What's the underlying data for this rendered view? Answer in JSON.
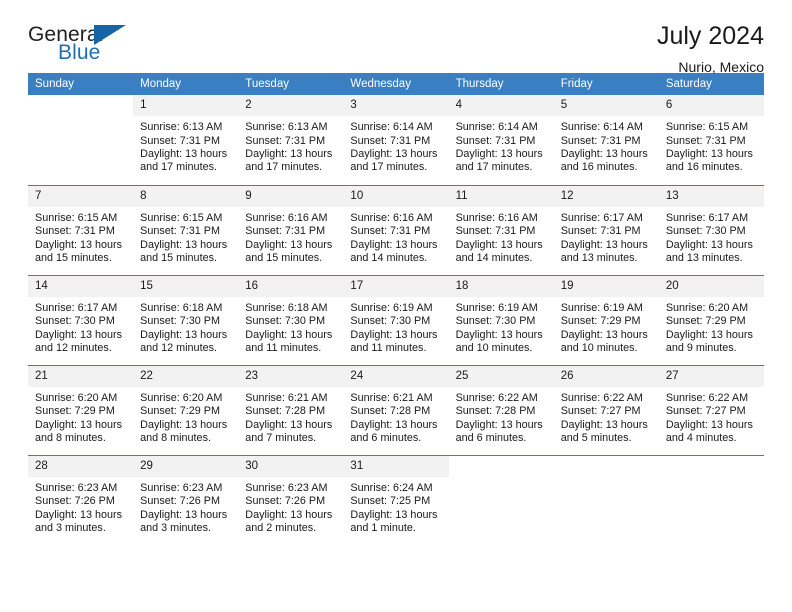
{
  "brand": {
    "name_part1": "General",
    "name_part2": "Blue",
    "accent_color": "#1565a8",
    "logo_icon": "triangle-icon"
  },
  "header": {
    "month_title": "July 2024",
    "location": "Nurio, Mexico"
  },
  "calendar": {
    "header_color": "#3a7fc1",
    "weekday_headers": [
      "Sunday",
      "Monday",
      "Tuesday",
      "Wednesday",
      "Thursday",
      "Friday",
      "Saturday"
    ],
    "weeks": [
      [
        {
          "day": "",
          "blank": true
        },
        {
          "day": "1",
          "sunrise": "Sunrise: 6:13 AM",
          "sunset": "Sunset: 7:31 PM",
          "daylight": "Daylight: 13 hours and 17 minutes."
        },
        {
          "day": "2",
          "sunrise": "Sunrise: 6:13 AM",
          "sunset": "Sunset: 7:31 PM",
          "daylight": "Daylight: 13 hours and 17 minutes."
        },
        {
          "day": "3",
          "sunrise": "Sunrise: 6:14 AM",
          "sunset": "Sunset: 7:31 PM",
          "daylight": "Daylight: 13 hours and 17 minutes."
        },
        {
          "day": "4",
          "sunrise": "Sunrise: 6:14 AM",
          "sunset": "Sunset: 7:31 PM",
          "daylight": "Daylight: 13 hours and 17 minutes."
        },
        {
          "day": "5",
          "sunrise": "Sunrise: 6:14 AM",
          "sunset": "Sunset: 7:31 PM",
          "daylight": "Daylight: 13 hours and 16 minutes."
        },
        {
          "day": "6",
          "sunrise": "Sunrise: 6:15 AM",
          "sunset": "Sunset: 7:31 PM",
          "daylight": "Daylight: 13 hours and 16 minutes."
        }
      ],
      [
        {
          "day": "7",
          "sunrise": "Sunrise: 6:15 AM",
          "sunset": "Sunset: 7:31 PM",
          "daylight": "Daylight: 13 hours and 15 minutes."
        },
        {
          "day": "8",
          "sunrise": "Sunrise: 6:15 AM",
          "sunset": "Sunset: 7:31 PM",
          "daylight": "Daylight: 13 hours and 15 minutes."
        },
        {
          "day": "9",
          "sunrise": "Sunrise: 6:16 AM",
          "sunset": "Sunset: 7:31 PM",
          "daylight": "Daylight: 13 hours and 15 minutes."
        },
        {
          "day": "10",
          "sunrise": "Sunrise: 6:16 AM",
          "sunset": "Sunset: 7:31 PM",
          "daylight": "Daylight: 13 hours and 14 minutes."
        },
        {
          "day": "11",
          "sunrise": "Sunrise: 6:16 AM",
          "sunset": "Sunset: 7:31 PM",
          "daylight": "Daylight: 13 hours and 14 minutes."
        },
        {
          "day": "12",
          "sunrise": "Sunrise: 6:17 AM",
          "sunset": "Sunset: 7:31 PM",
          "daylight": "Daylight: 13 hours and 13 minutes."
        },
        {
          "day": "13",
          "sunrise": "Sunrise: 6:17 AM",
          "sunset": "Sunset: 7:30 PM",
          "daylight": "Daylight: 13 hours and 13 minutes."
        }
      ],
      [
        {
          "day": "14",
          "sunrise": "Sunrise: 6:17 AM",
          "sunset": "Sunset: 7:30 PM",
          "daylight": "Daylight: 13 hours and 12 minutes."
        },
        {
          "day": "15",
          "sunrise": "Sunrise: 6:18 AM",
          "sunset": "Sunset: 7:30 PM",
          "daylight": "Daylight: 13 hours and 12 minutes."
        },
        {
          "day": "16",
          "sunrise": "Sunrise: 6:18 AM",
          "sunset": "Sunset: 7:30 PM",
          "daylight": "Daylight: 13 hours and 11 minutes."
        },
        {
          "day": "17",
          "sunrise": "Sunrise: 6:19 AM",
          "sunset": "Sunset: 7:30 PM",
          "daylight": "Daylight: 13 hours and 11 minutes."
        },
        {
          "day": "18",
          "sunrise": "Sunrise: 6:19 AM",
          "sunset": "Sunset: 7:30 PM",
          "daylight": "Daylight: 13 hours and 10 minutes."
        },
        {
          "day": "19",
          "sunrise": "Sunrise: 6:19 AM",
          "sunset": "Sunset: 7:29 PM",
          "daylight": "Daylight: 13 hours and 10 minutes."
        },
        {
          "day": "20",
          "sunrise": "Sunrise: 6:20 AM",
          "sunset": "Sunset: 7:29 PM",
          "daylight": "Daylight: 13 hours and 9 minutes."
        }
      ],
      [
        {
          "day": "21",
          "sunrise": "Sunrise: 6:20 AM",
          "sunset": "Sunset: 7:29 PM",
          "daylight": "Daylight: 13 hours and 8 minutes."
        },
        {
          "day": "22",
          "sunrise": "Sunrise: 6:20 AM",
          "sunset": "Sunset: 7:29 PM",
          "daylight": "Daylight: 13 hours and 8 minutes."
        },
        {
          "day": "23",
          "sunrise": "Sunrise: 6:21 AM",
          "sunset": "Sunset: 7:28 PM",
          "daylight": "Daylight: 13 hours and 7 minutes."
        },
        {
          "day": "24",
          "sunrise": "Sunrise: 6:21 AM",
          "sunset": "Sunset: 7:28 PM",
          "daylight": "Daylight: 13 hours and 6 minutes."
        },
        {
          "day": "25",
          "sunrise": "Sunrise: 6:22 AM",
          "sunset": "Sunset: 7:28 PM",
          "daylight": "Daylight: 13 hours and 6 minutes."
        },
        {
          "day": "26",
          "sunrise": "Sunrise: 6:22 AM",
          "sunset": "Sunset: 7:27 PM",
          "daylight": "Daylight: 13 hours and 5 minutes."
        },
        {
          "day": "27",
          "sunrise": "Sunrise: 6:22 AM",
          "sunset": "Sunset: 7:27 PM",
          "daylight": "Daylight: 13 hours and 4 minutes."
        }
      ],
      [
        {
          "day": "28",
          "sunrise": "Sunrise: 6:23 AM",
          "sunset": "Sunset: 7:26 PM",
          "daylight": "Daylight: 13 hours and 3 minutes."
        },
        {
          "day": "29",
          "sunrise": "Sunrise: 6:23 AM",
          "sunset": "Sunset: 7:26 PM",
          "daylight": "Daylight: 13 hours and 3 minutes."
        },
        {
          "day": "30",
          "sunrise": "Sunrise: 6:23 AM",
          "sunset": "Sunset: 7:26 PM",
          "daylight": "Daylight: 13 hours and 2 minutes."
        },
        {
          "day": "31",
          "sunrise": "Sunrise: 6:24 AM",
          "sunset": "Sunset: 7:25 PM",
          "daylight": "Daylight: 13 hours and 1 minute."
        },
        {
          "day": "",
          "blank": true
        },
        {
          "day": "",
          "blank": true
        },
        {
          "day": "",
          "blank": true
        }
      ]
    ]
  }
}
